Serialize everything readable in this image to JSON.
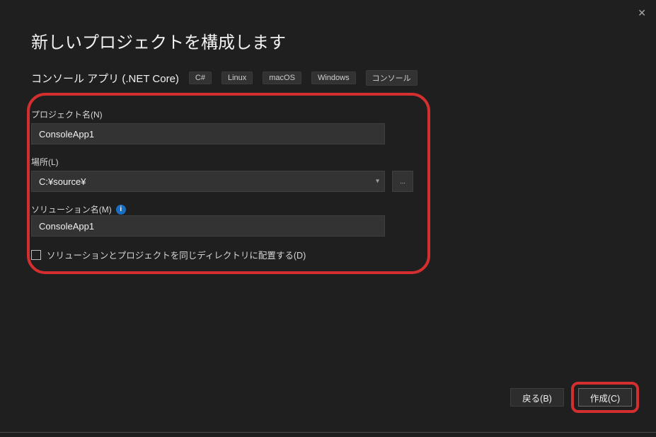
{
  "header": {
    "title": "新しいプロジェクトを構成します",
    "template_name": "コンソール アプリ (.NET Core)",
    "tags": [
      "C#",
      "Linux",
      "macOS",
      "Windows",
      "コンソール"
    ]
  },
  "fields": {
    "project_name": {
      "label": "プロジェクト名(N)",
      "value": "ConsoleApp1"
    },
    "location": {
      "label": "場所(L)",
      "value": "C:¥source¥",
      "browse_label": "..."
    },
    "solution_name": {
      "label": "ソリューション名(M)",
      "value": "ConsoleApp1"
    },
    "same_dir_checkbox": {
      "checked": false,
      "label": "ソリューションとプロジェクトを同じディレクトリに配置する(D)"
    }
  },
  "footer": {
    "back": "戻る(B)",
    "create": "作成(C)"
  },
  "icons": {
    "info": "i",
    "close": "✕",
    "chevron_down": "▾"
  }
}
